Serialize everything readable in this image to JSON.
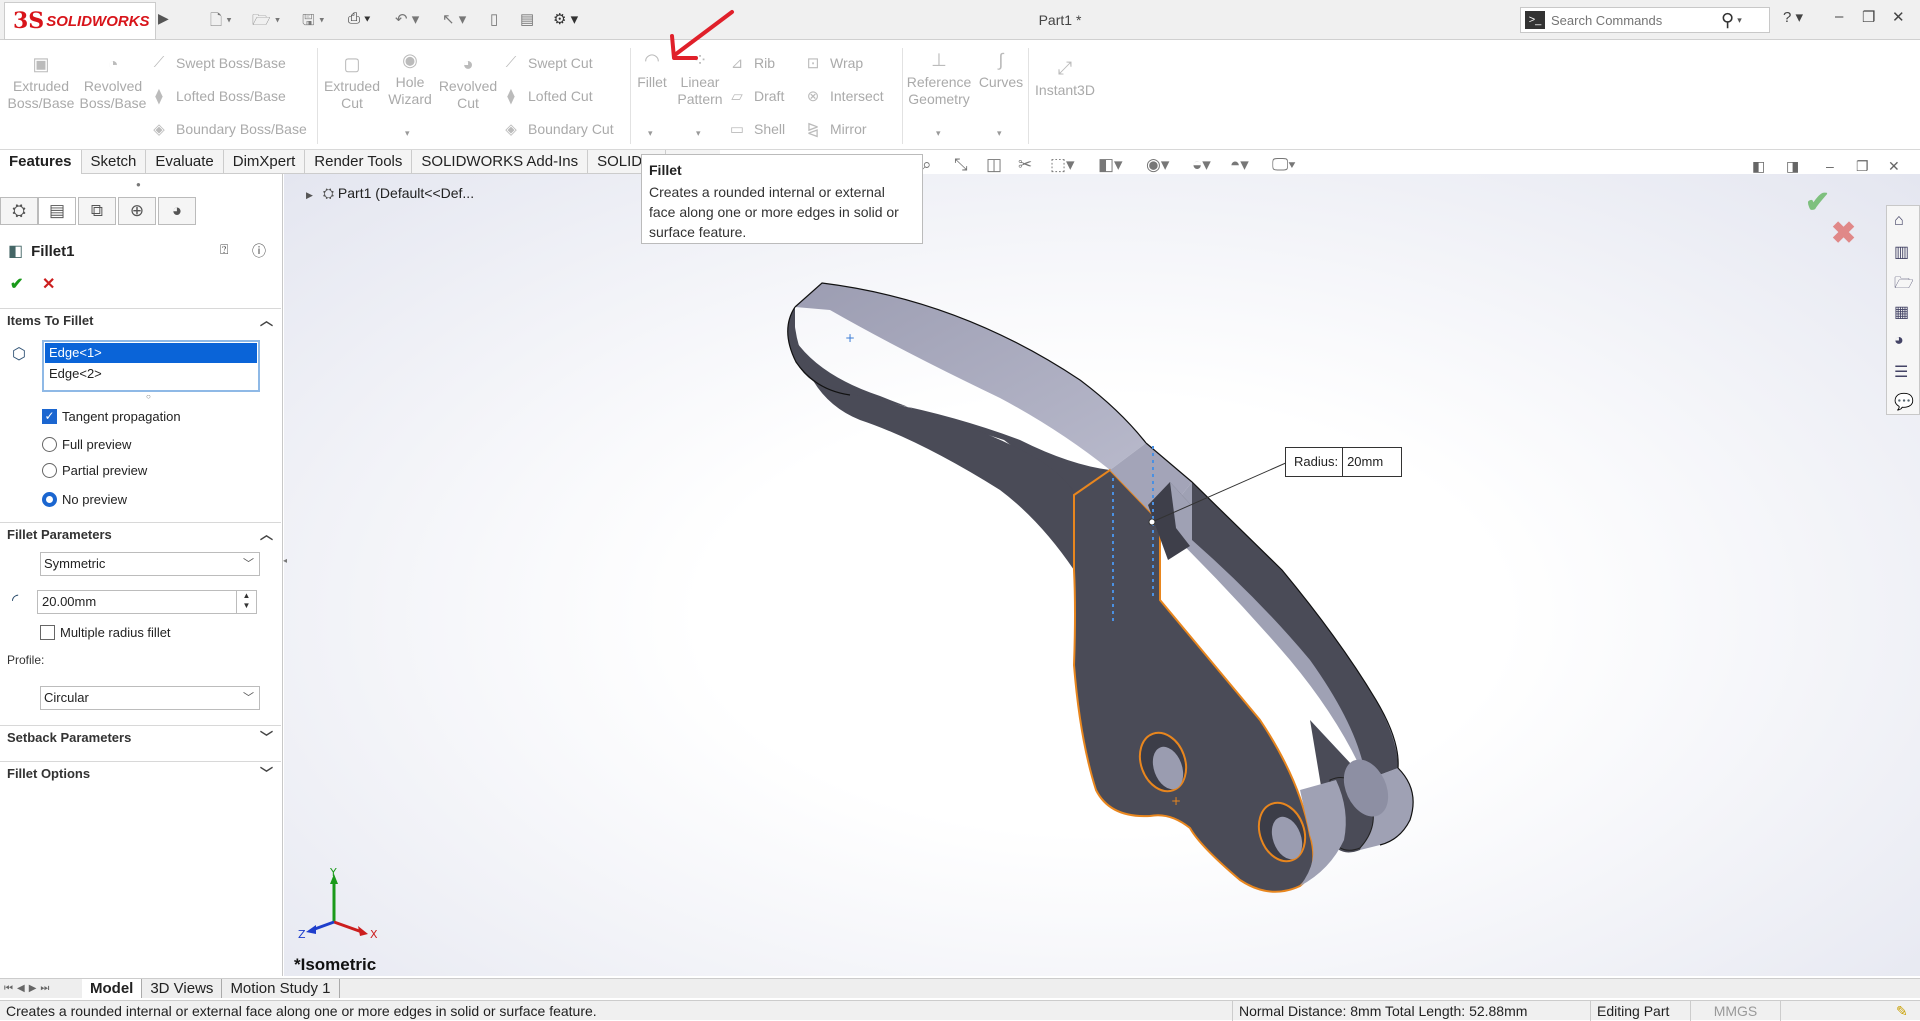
{
  "app": {
    "brand_ds": "3S",
    "brand_name": "SOLIDWORKS",
    "title": "Part1 *"
  },
  "search": {
    "placeholder": "Search Commands"
  },
  "ribbon": {
    "extruded_boss": "Extruded\nBoss/Base",
    "revolved_boss": "Revolved\nBoss/Base",
    "swept_boss": "Swept Boss/Base",
    "lofted_boss": "Lofted Boss/Base",
    "boundary_boss": "Boundary Boss/Base",
    "extruded_cut": "Extruded\nCut",
    "hole_wizard": "Hole\nWizard",
    "revolved_cut": "Revolved\nCut",
    "swept_cut": "Swept Cut",
    "lofted_cut": "Lofted Cut",
    "boundary_cut": "Boundary Cut",
    "fillet": "Fillet",
    "linear_pattern": "Linear\nPattern",
    "rib": "Rib",
    "draft": "Draft",
    "shell": "Shell",
    "wrap": "Wrap",
    "intersect": "Intersect",
    "mirror": "Mirror",
    "reference_geometry": "Reference\nGeometry",
    "curves": "Curves",
    "instant3d": "Instant3D"
  },
  "cm_tabs": [
    "Features",
    "Sketch",
    "Evaluate",
    "DimXpert",
    "Render Tools",
    "SOLIDWORKS Add-Ins",
    "SOLIDW"
  ],
  "tooltip": {
    "title": "Fillet",
    "text": "Creates a rounded internal or external face along one or more edges in solid or surface feature."
  },
  "tree": {
    "root": "Part1  (Default<<Def..."
  },
  "property_manager": {
    "feature_name": "Fillet1",
    "items_header": "Items To Fillet",
    "edges": [
      "Edge<1>",
      "Edge<2>"
    ],
    "tangent_propagation": "Tangent propagation",
    "full_preview": "Full preview",
    "partial_preview": "Partial preview",
    "no_preview": "No preview",
    "params_header": "Fillet Parameters",
    "fillet_method": "Symmetric",
    "radius_value": "20.00mm",
    "multiple_radius": "Multiple radius fillet",
    "profile_label": "Profile:",
    "profile_value": "Circular",
    "setback_header": "Setback Parameters",
    "options_header": "Fillet Options"
  },
  "callout": {
    "label": "Radius:",
    "value": "20mm"
  },
  "triad": {
    "x": "X",
    "y": "Y",
    "z": "Z"
  },
  "view_name": "*Isometric",
  "bottom_tabs": [
    "Model",
    "3D Views",
    "Motion Study 1"
  ],
  "status": {
    "message": "Creates a rounded internal or external face along one or more edges in solid or surface feature.",
    "measure": "Normal Distance: 8mm Total Length: 52.88mm",
    "mode": "Editing Part",
    "units": "MMGS"
  },
  "colors": {
    "brand": "#d8141a",
    "selection": "#0a64d8",
    "edge_highlight": "#e8861e",
    "part_dark": "#4a4b57",
    "part_light": "#9fa1b4"
  }
}
